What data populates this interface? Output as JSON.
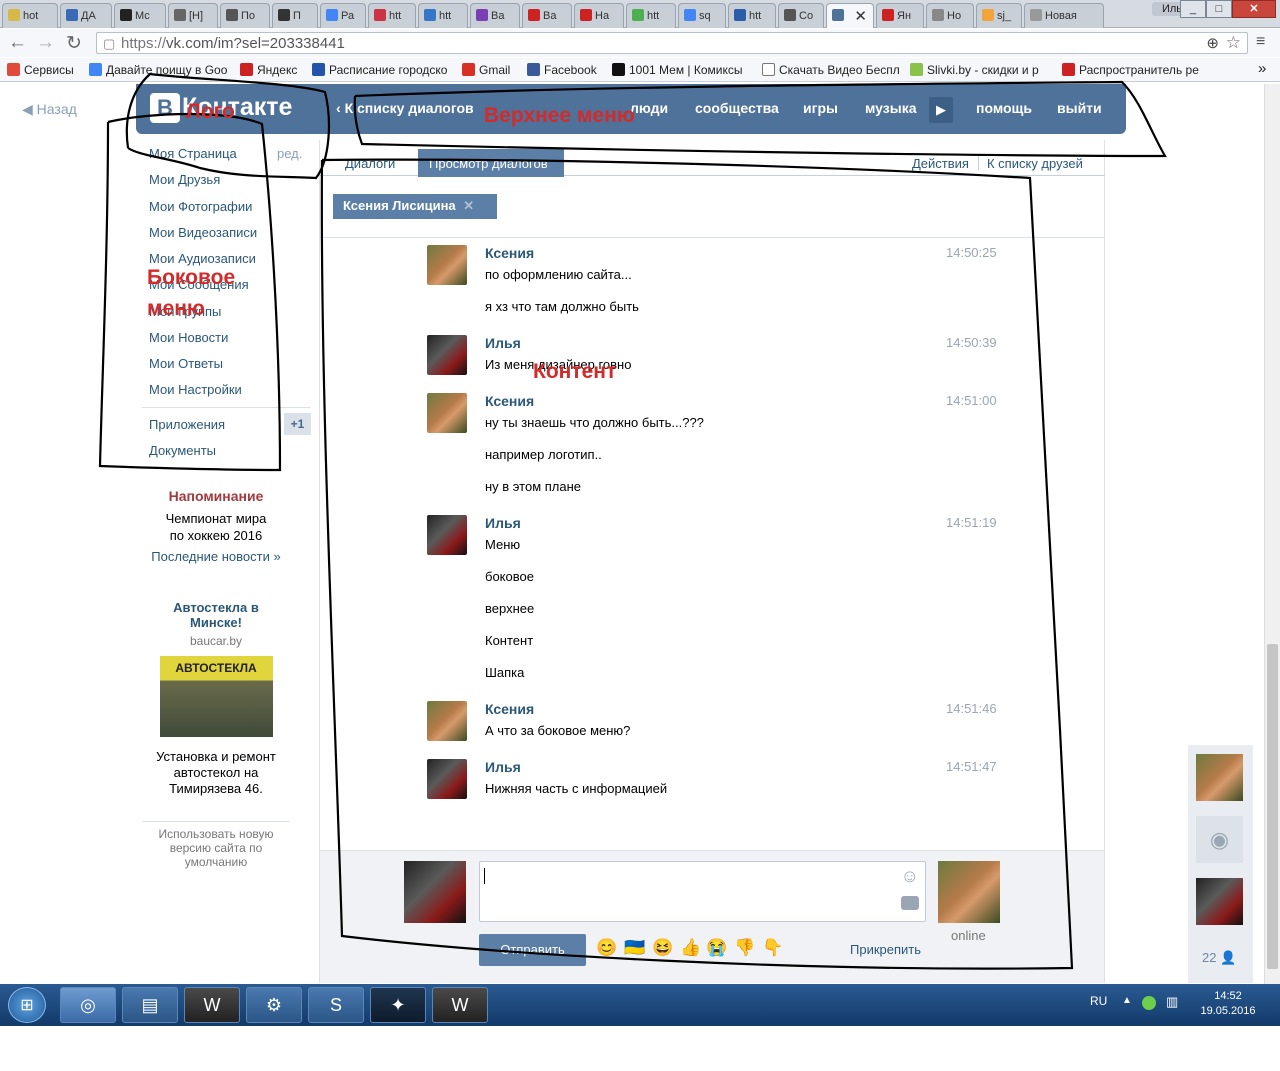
{
  "browser": {
    "tabs": [
      {
        "label": "hot",
        "color": "#d9b84a",
        "icon": "folder-icon"
      },
      {
        "label": "ДА",
        "color": "#3a69b6",
        "icon": "flag-icon"
      },
      {
        "label": "Мс",
        "color": "#222222",
        "icon": "t-icon"
      },
      {
        "label": "[Н]",
        "color": "#666666",
        "icon": "page-icon"
      },
      {
        "label": "По",
        "color": "#555555",
        "icon": "mail-icon"
      },
      {
        "label": "П",
        "color": "#333333",
        "icon": "puzzle-icon"
      },
      {
        "label": "Ра",
        "color": "#4285f4",
        "icon": "google-icon"
      },
      {
        "label": "htt",
        "color": "#cc3344",
        "icon": "search-icon"
      },
      {
        "label": "htt",
        "color": "#3576c8",
        "icon": "d-icon"
      },
      {
        "label": "Ва",
        "color": "#7b3fb5",
        "icon": "p-icon"
      },
      {
        "label": "Ва",
        "color": "#cc2222",
        "icon": "shield-icon"
      },
      {
        "label": "На",
        "color": "#cc2222",
        "icon": "shield-icon"
      },
      {
        "label": "htt",
        "color": "#4caf50",
        "icon": "pin-icon"
      },
      {
        "label": "sq",
        "color": "#4285f4",
        "icon": "google-icon"
      },
      {
        "label": "htt",
        "color": "#2a5ea8",
        "icon": "r-icon"
      },
      {
        "label": "Co",
        "color": "#555555",
        "icon": "mail-icon"
      },
      {
        "label": "",
        "color": "#4e729a",
        "icon": "vk-icon",
        "active": true
      },
      {
        "label": "Ян",
        "color": "#cc2222",
        "icon": "yandex-icon"
      },
      {
        "label": "Но",
        "color": "#888888",
        "icon": "page-icon"
      },
      {
        "label": "sj_",
        "color": "#f2a33a",
        "icon": "cloud-icon"
      },
      {
        "label": "Новая",
        "color": "#999999",
        "icon": "page-icon"
      }
    ],
    "user_chip": "Илья",
    "url_scheme": "https://",
    "url_rest": "vk.com/im?sel=203338441",
    "bookmarks": [
      {
        "label": "Сервисы",
        "color": "#e04a3a",
        "icon": "apps-icon"
      },
      {
        "label": "Давайте поищу в Goo",
        "color": "#4285f4",
        "icon": "google-icon"
      },
      {
        "label": "Яндекс",
        "color": "#cc2222",
        "icon": "yandex-icon"
      },
      {
        "label": "Расписание городско",
        "color": "#2255aa",
        "icon": "bus-icon"
      },
      {
        "label": "Gmail",
        "color": "#d93025",
        "icon": "gmail-icon"
      },
      {
        "label": "Facebook",
        "color": "#3b5998",
        "icon": "facebook-icon"
      },
      {
        "label": "1001 Мем | Комиксы",
        "color": "#111111",
        "icon": "m-icon"
      },
      {
        "label": "Скачать Видео Беспл",
        "color": "#777777",
        "icon": "page-icon"
      },
      {
        "label": "Slivki.by - скидки и р",
        "color": "#8bc34a",
        "icon": "y-icon"
      },
      {
        "label": "Распространитель ре",
        "color": "#cc2222",
        "icon": "flag-icon"
      }
    ]
  },
  "vk": {
    "back": "Назад",
    "logo": "Контакте",
    "logo_letter": "В",
    "top_nav": {
      "dialogs": "К списку диалогов",
      "people": "люди",
      "communities": "сообщества",
      "games": "игры",
      "music": "музыка",
      "help": "помощь",
      "exit": "выйти"
    },
    "side_menu": [
      "Моя Страница",
      "Мои Друзья",
      "Мои Фотографии",
      "Мои Видеозаписи",
      "Мои Аудиозаписи",
      "Мои Сообщения",
      "Мои Группы",
      "Мои Новости",
      "Мои Ответы",
      "Мои Настройки"
    ],
    "side_edit": "ред.",
    "apps": "Приложения",
    "apps_badge": "+1",
    "docs": "Документы",
    "reminder": {
      "title": "Напоминание",
      "line1": "Чемпионат мира",
      "line2": "по хоккею 2016",
      "link": "Последние новости »"
    },
    "ad": {
      "title": "Автостекла в Минске!",
      "domain": "baucar.by",
      "image_text": "АВТОСТЕКЛА",
      "text": "Установка и ремонт автостекол на Тимирязева 46."
    },
    "new_version": "Использовать новую версию сайта по умолчанию",
    "tabs": {
      "dialogs": "Диалоги",
      "view": "Просмотр диалогов",
      "actions": "Действия",
      "friends": "К списку друзей"
    },
    "chip": "Ксения Лисицина",
    "messages": [
      {
        "name": "Ксения",
        "time": "14:50:25",
        "lines": [
          "по оформлению сайта...",
          "я хз что там должно быть"
        ]
      },
      {
        "name": "Илья",
        "time": "14:50:39",
        "lines": [
          "Из меня дизайнер говно"
        ]
      },
      {
        "name": "Ксения",
        "time": "14:51:00",
        "lines": [
          "ну ты знаешь что должно быть...???",
          "например логотип..",
          "ну в этом плане"
        ]
      },
      {
        "name": "Илья",
        "time": "14:51:19",
        "lines": [
          "Меню",
          "боковое",
          "верхнее",
          "Контент",
          "Шапка"
        ]
      },
      {
        "name": "Ксения",
        "time": "14:51:46",
        "lines": [
          "А что за боковое меню?"
        ]
      },
      {
        "name": "Илья",
        "time": "14:51:47",
        "lines": [
          "Нижняя часть с информацией"
        ]
      }
    ],
    "send": "Отправить",
    "attach": "Прикрепить",
    "online": "online",
    "rail_count": "22"
  },
  "annotations": {
    "logo": "Лого",
    "top_menu": "Верхнее меню",
    "side_menu_1": "Боковое",
    "side_menu_2": "меню",
    "content": "Контент"
  },
  "taskbar": {
    "lang": "RU",
    "time": "14:52",
    "date": "19.05.2016"
  }
}
